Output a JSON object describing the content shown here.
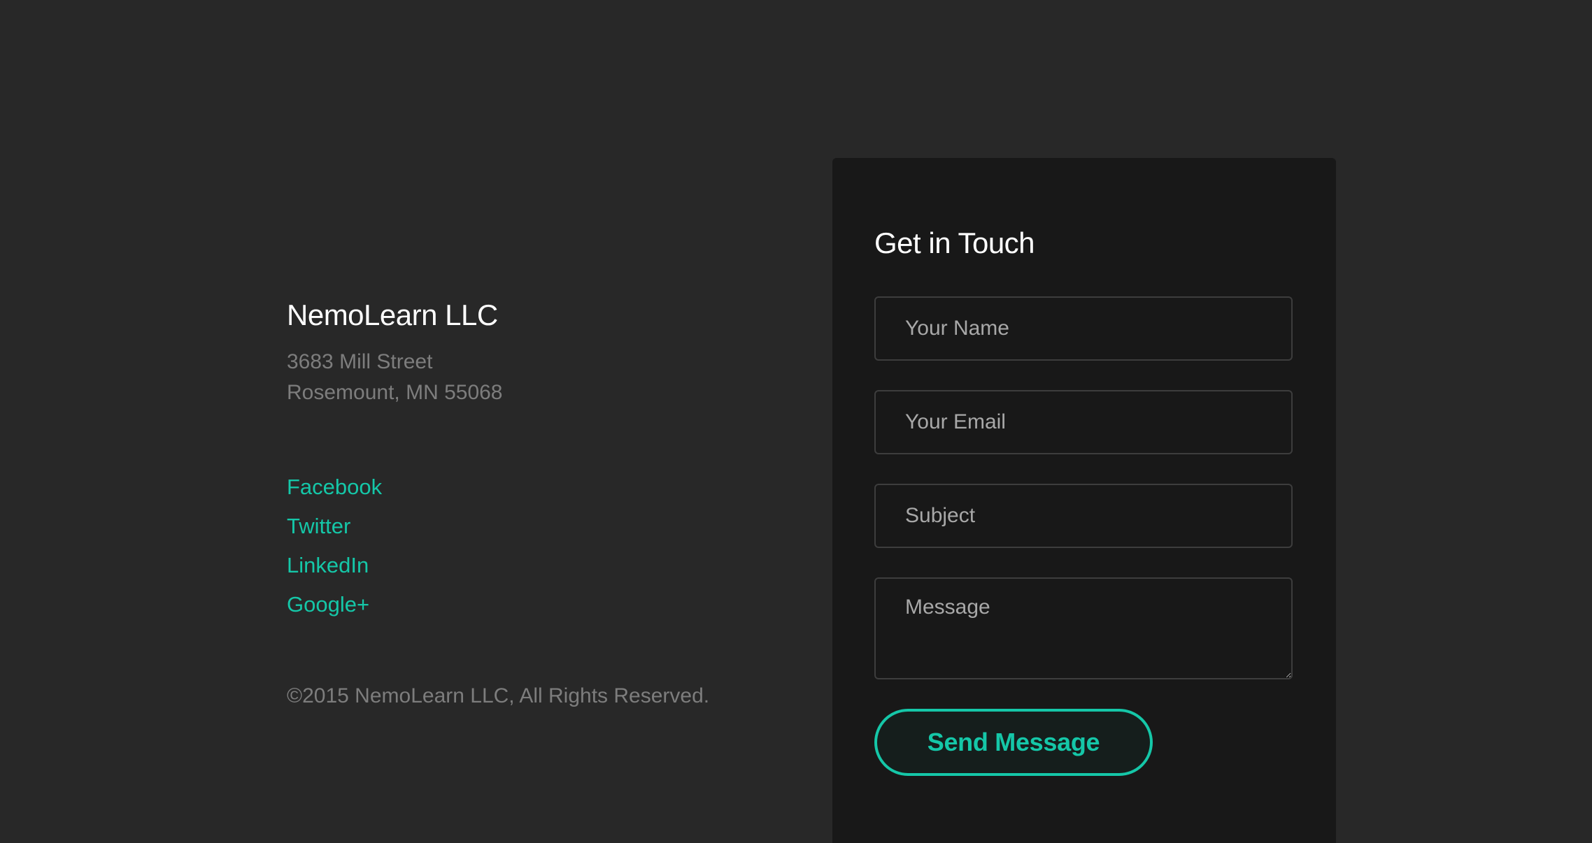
{
  "company": {
    "name": "NemoLearn LLC",
    "address_line1": "3683 Mill Street",
    "address_line2": "Rosemount, MN 55068",
    "copyright": "©2015 NemoLearn LLC, All Rights Reserved."
  },
  "social": {
    "facebook": "Facebook",
    "twitter": "Twitter",
    "linkedin": "LinkedIn",
    "googleplus": "Google+"
  },
  "contact_form": {
    "title": "Get in Touch",
    "name_placeholder": "Your Name",
    "email_placeholder": "Your Email",
    "subject_placeholder": "Subject",
    "message_placeholder": "Message",
    "submit_label": "Send Message"
  },
  "colors": {
    "background": "#282828",
    "card_background": "#181818",
    "accent": "#15c7a8",
    "muted_text": "#7d7d7d"
  }
}
